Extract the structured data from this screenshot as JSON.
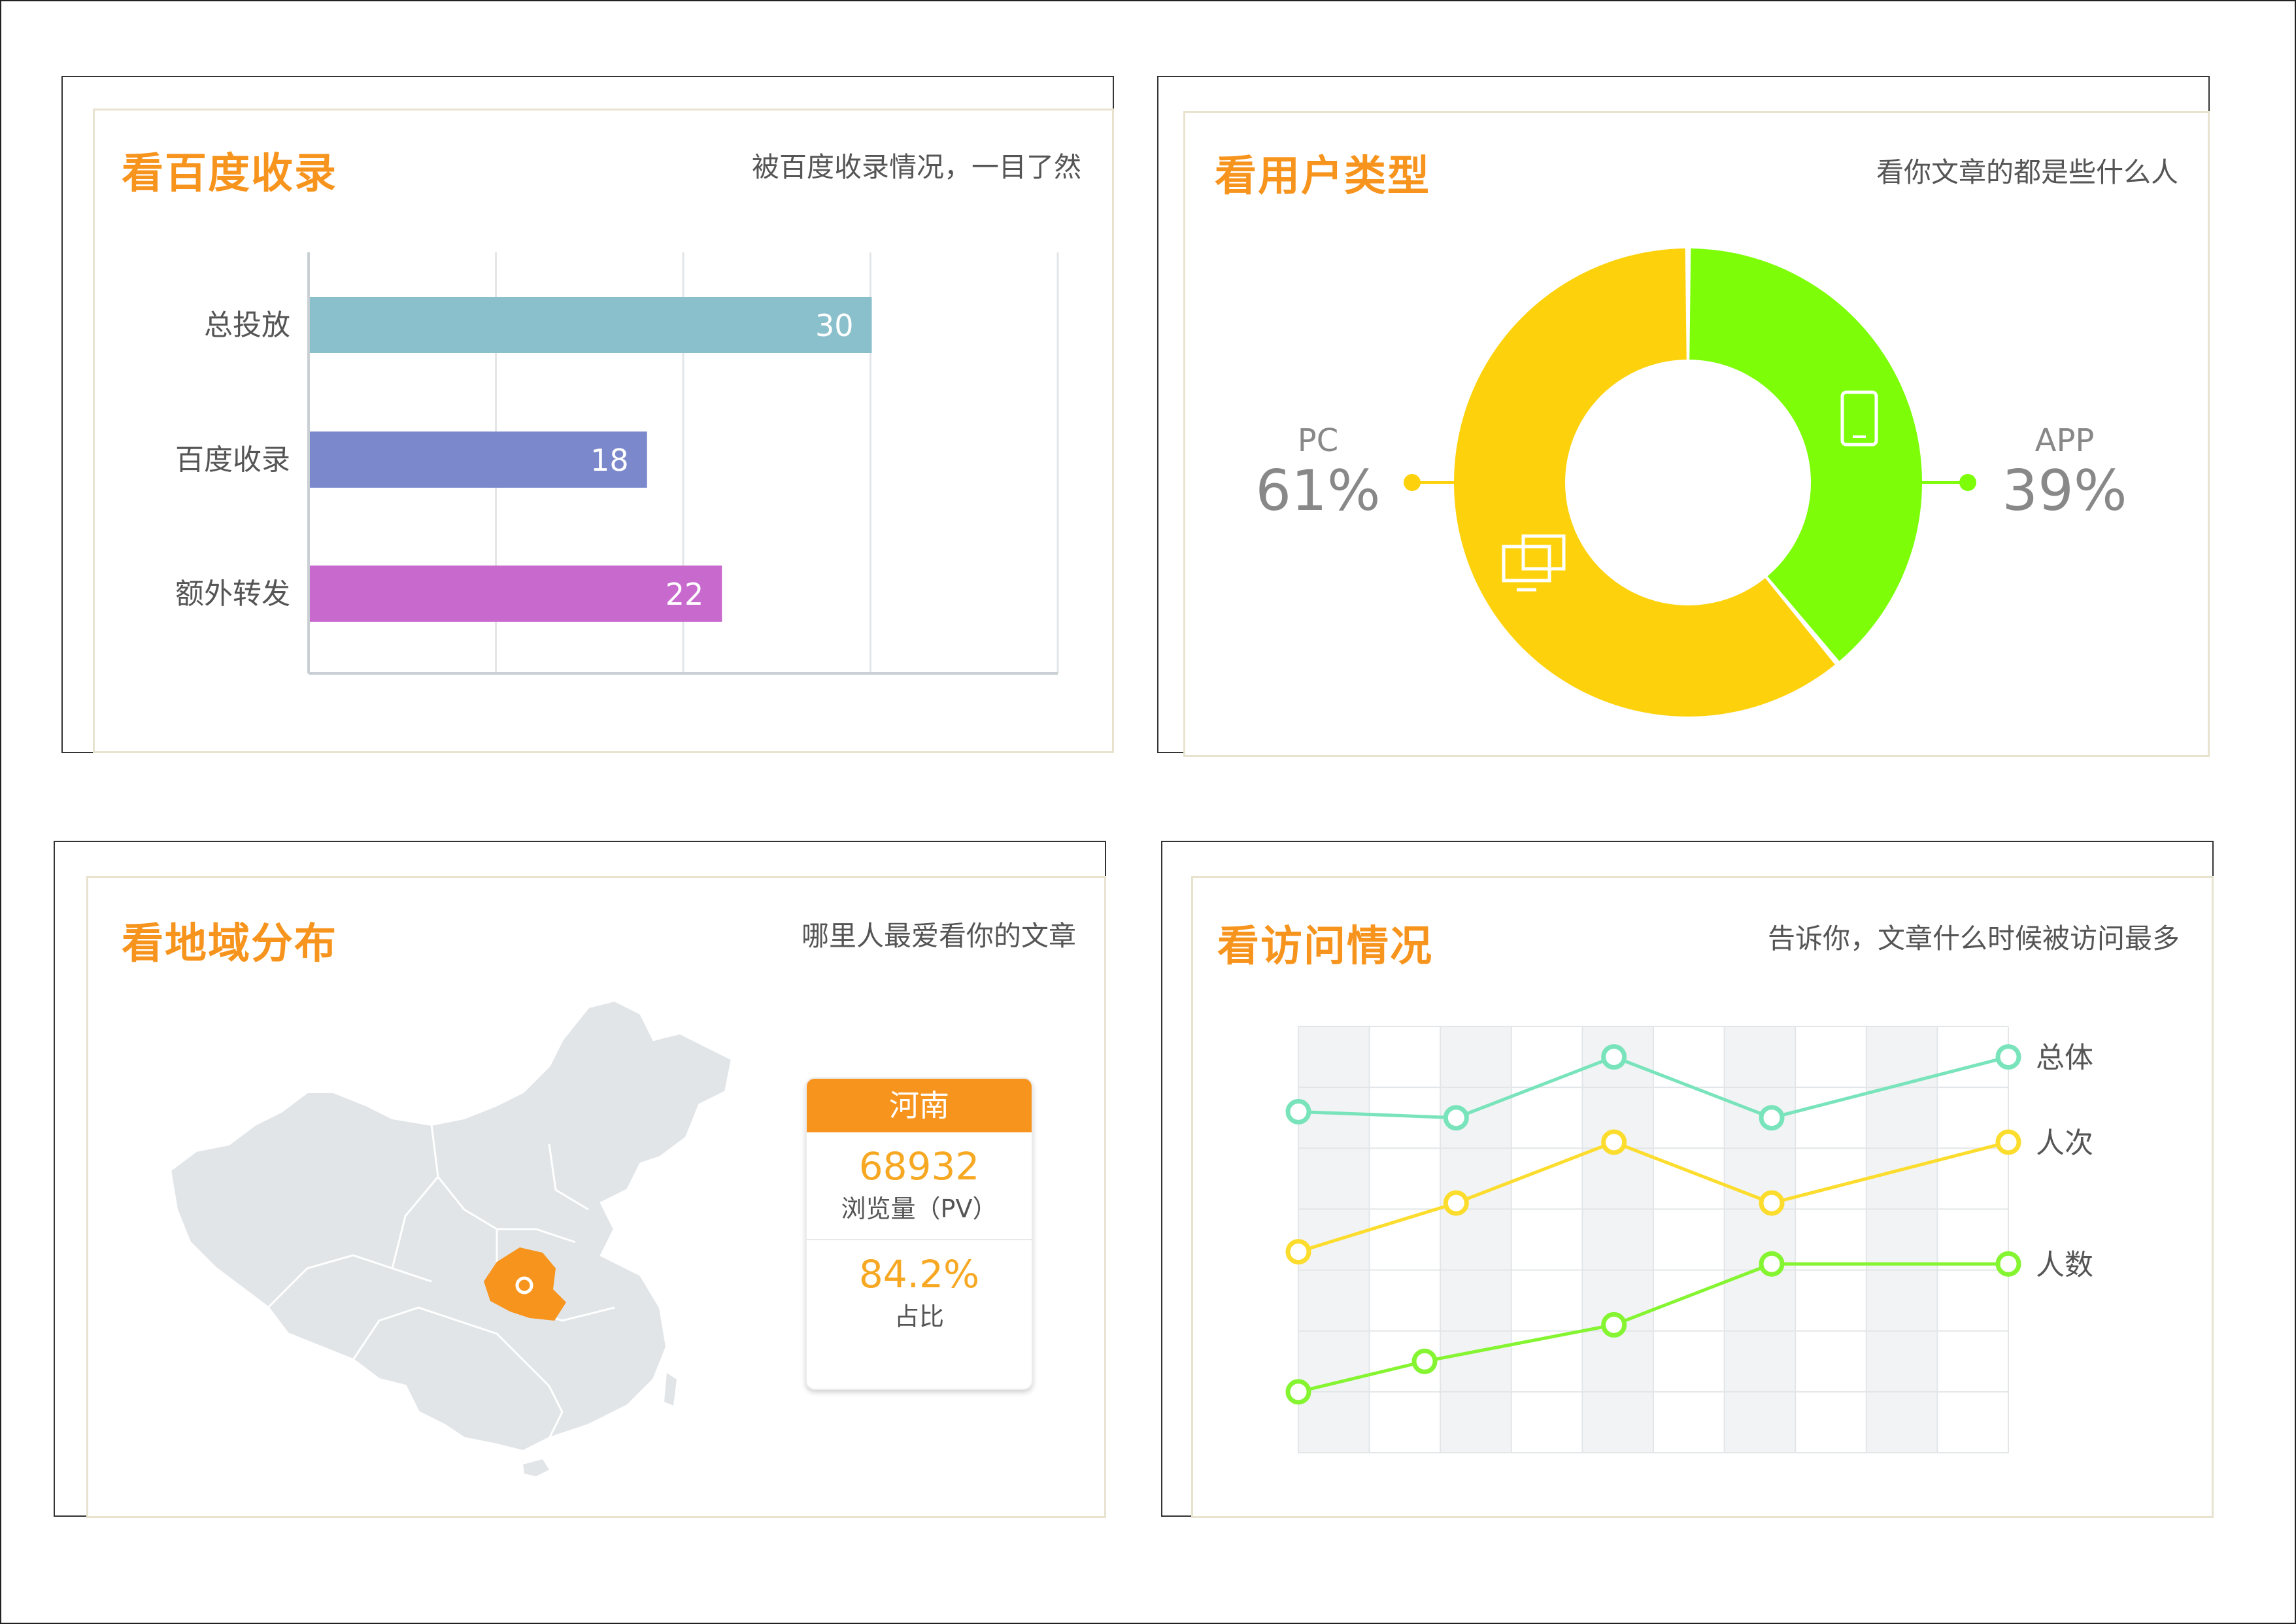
{
  "panels": {
    "baidu": {
      "title": "看百度收录",
      "subtitle": "被百度收录情况，一目了然"
    },
    "users": {
      "title": "看用户类型",
      "subtitle": "看你文章的都是些什么人"
    },
    "region": {
      "title": "看地域分布",
      "subtitle": "哪里人最爱看你的文章"
    },
    "visits": {
      "title": "看访问情况",
      "subtitle": "告诉你，文章什么时候被访问最多"
    }
  },
  "region_card": {
    "province": "河南",
    "pv_value": "68932",
    "pv_label": "浏览量（PV）",
    "ratio_value": "84.2%",
    "ratio_label": "占比"
  },
  "pie_labels": {
    "pc_name": "PC",
    "pc_pct": "61%",
    "app_name": "APP",
    "app_pct": "39%"
  },
  "colors": {
    "accent": "#f7941d",
    "bar_total": "#8ac0cb",
    "bar_baidu": "#7b89cc",
    "bar_extra": "#c86acd",
    "pie_pc": "#fdd20c",
    "pie_app": "#7dfd08",
    "line_total": "#79e4bb",
    "line_visits": "#fcdc2c",
    "line_people": "#85f431",
    "map_fill": "#e1e5e8",
    "map_highlight": "#f7941d"
  },
  "chart_data": [
    {
      "type": "bar",
      "orientation": "horizontal",
      "categories": [
        "总投放",
        "百度收录",
        "额外转发"
      ],
      "values": [
        30,
        18,
        22
      ],
      "xlim": [
        0,
        40
      ],
      "grid": true
    },
    {
      "type": "pie",
      "donut": true,
      "labels": [
        "PC",
        "APP"
      ],
      "values": [
        61,
        39
      ],
      "icons": [
        "desktop-icon",
        "mobile-icon"
      ]
    },
    {
      "type": "line",
      "x_count": 10,
      "ylim": [
        0,
        7
      ],
      "series": [
        {
          "name": "总体",
          "x": [
            0,
            2,
            4,
            6,
            9
          ],
          "values": [
            5.6,
            5.5,
            6.5,
            5.5,
            6.5
          ]
        },
        {
          "name": "人次",
          "x": [
            0,
            2,
            4,
            6,
            9
          ],
          "values": [
            3.3,
            4.1,
            5.1,
            4.1,
            5.1
          ]
        },
        {
          "name": "人数",
          "x": [
            0,
            1.6,
            4,
            6,
            9
          ],
          "values": [
            1.0,
            1.5,
            2.1,
            3.1,
            3.1
          ]
        }
      ],
      "grid": true
    }
  ]
}
